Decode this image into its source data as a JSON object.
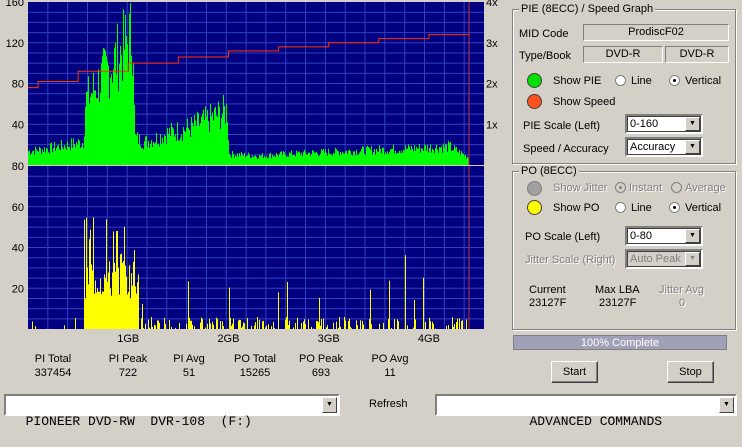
{
  "chart_data": [
    {
      "type": "area",
      "title": "",
      "ylabel_left": "PIE",
      "ylabel_right": "Speed",
      "left_ticks": [
        "160",
        "120",
        "80",
        "40"
      ],
      "right_ticks": [
        "4x",
        "3x",
        "2x",
        "1x"
      ],
      "ylim": [
        0,
        160
      ],
      "y2lim": [
        0,
        4
      ],
      "grid": true,
      "series": [
        {
          "color": "#00ff00",
          "x": [
            0.0,
            0.2,
            0.4,
            0.55,
            0.57,
            0.7,
            0.9,
            1.05,
            1.06,
            1.15,
            1.25,
            1.4,
            1.6,
            1.8,
            1.99,
            2.0,
            2.3,
            2.6,
            3.0,
            3.4,
            3.8,
            4.2,
            4.4
          ],
          "values": [
            15,
            18,
            22,
            25,
            70,
            90,
            120,
            145,
            30,
            25,
            28,
            35,
            40,
            50,
            60,
            12,
            10,
            12,
            14,
            16,
            18,
            20,
            8
          ]
        },
        {
          "color": "#ff3300",
          "x": [
            0.0,
            0.1,
            0.5,
            1.0,
            1.5,
            2.0,
            2.5,
            3.0,
            3.5,
            4.0,
            4.4
          ],
          "values": [
            1.9,
            2.05,
            2.3,
            2.5,
            2.65,
            2.8,
            2.9,
            3.0,
            3.1,
            3.2,
            3.25
          ]
        }
      ]
    },
    {
      "type": "bar",
      "title": "",
      "ylabel": "PO",
      "left_ticks": [
        "80",
        "60",
        "40",
        "20"
      ],
      "ylim": [
        0,
        80
      ],
      "grid": true,
      "x_ticks": [
        "1GB",
        "2GB",
        "3GB",
        "4GB"
      ],
      "series": [
        {
          "color": "#ffff00",
          "x": [
            0.55,
            0.7,
            0.85,
            0.9,
            1.0,
            1.05,
            1.1,
            1.3,
            1.6,
            2.0,
            2.4,
            2.8,
            3.2,
            3.6,
            3.9,
            4.1,
            4.3
          ],
          "values": [
            35,
            40,
            45,
            50,
            38,
            40,
            5,
            4,
            5,
            4,
            4,
            5,
            5,
            6,
            40,
            32,
            10
          ]
        }
      ]
    }
  ],
  "stats": {
    "pi_total": {
      "label": "PI Total",
      "value": "337454"
    },
    "pi_peak": {
      "label": "PI Peak",
      "value": "722"
    },
    "pi_avg": {
      "label": "PI Avg",
      "value": "51"
    },
    "po_total": {
      "label": "PO Total",
      "value": "15265"
    },
    "po_peak": {
      "label": "PO Peak",
      "value": "693"
    },
    "po_avg": {
      "label": "PO Avg",
      "value": "11"
    }
  },
  "pie_group": {
    "title": "PIE (8ECC) / Speed Graph",
    "mid_code_label": "MID Code",
    "mid_code_value": "ProdiscF02",
    "type_book_label": "Type/Book",
    "type_value": "DVD-R",
    "book_value": "DVD-R",
    "show_pie_label": "Show PIE",
    "line_label": "Line",
    "vertical_label": "Vertical",
    "show_speed_label": "Show Speed",
    "pie_scale_label": "PIE Scale (Left)",
    "pie_scale_value": "0-160",
    "speed_accuracy_label": "Speed / Accuracy",
    "speed_accuracy_value": "Accuracy",
    "pie_color": "#00e000",
    "speed_color": "#ff5020"
  },
  "po_group": {
    "title": "PO (8ECC)",
    "show_jitter_label": "Show Jitter",
    "instant_label": "Instant",
    "average_label": "Average",
    "show_po_label": "Show PO",
    "line_label": "Line",
    "vertical_label": "Vertical",
    "po_scale_label": "PO Scale (Left)",
    "po_scale_value": "0-80",
    "jitter_scale_label": "Jitter Scale (Right)",
    "jitter_scale_value": "Auto Peak",
    "current_label": "Current",
    "current_value": "23127F",
    "max_lba_label": "Max LBA",
    "max_lba_value": "23127F",
    "jitter_avg_label": "Jitter Avg",
    "jitter_avg_value": "0",
    "po_color": "#ffff00"
  },
  "progress": {
    "text": "100% Complete",
    "fraction": 1.0
  },
  "buttons": {
    "start": "Start",
    "stop": "Stop",
    "refresh": "Refresh"
  },
  "bottom": {
    "drive": "PIONEER DVD-RW  DVR-108  (F:)",
    "commands": "ADVANCED COMMANDS"
  }
}
